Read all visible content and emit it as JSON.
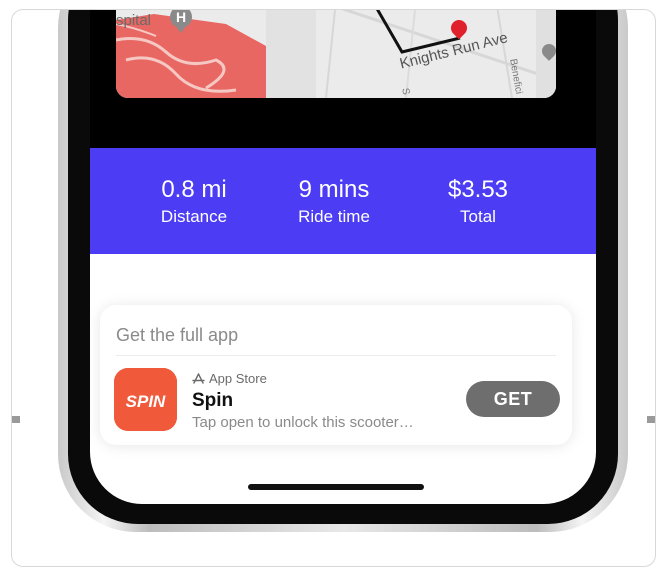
{
  "map": {
    "hospital_label": "spital",
    "hospital_icon": "H",
    "street_name": "Knights Run Ave",
    "side_street": "Benefici",
    "s_label": "S"
  },
  "stats": [
    {
      "value": "0.8 mi",
      "label": "Distance"
    },
    {
      "value": "9 mins",
      "label": "Ride time"
    },
    {
      "value": "$3.53",
      "label": "Total"
    }
  ],
  "app_clip": {
    "header": "Get the full app",
    "store_label": "App Store",
    "app_name": "Spin",
    "subtitle": "Tap open to unlock this scooter…",
    "get_label": "GET",
    "icon_text": "SPIN"
  },
  "colors": {
    "accent": "#4c3cf4",
    "app_icon": "#f05a3a",
    "map_pin": "#e0202a",
    "get_button": "#6e6e6e"
  },
  "icons": [
    "hospital-icon",
    "map-pin-icon",
    "app-store-icon",
    "spin-app-icon"
  ]
}
